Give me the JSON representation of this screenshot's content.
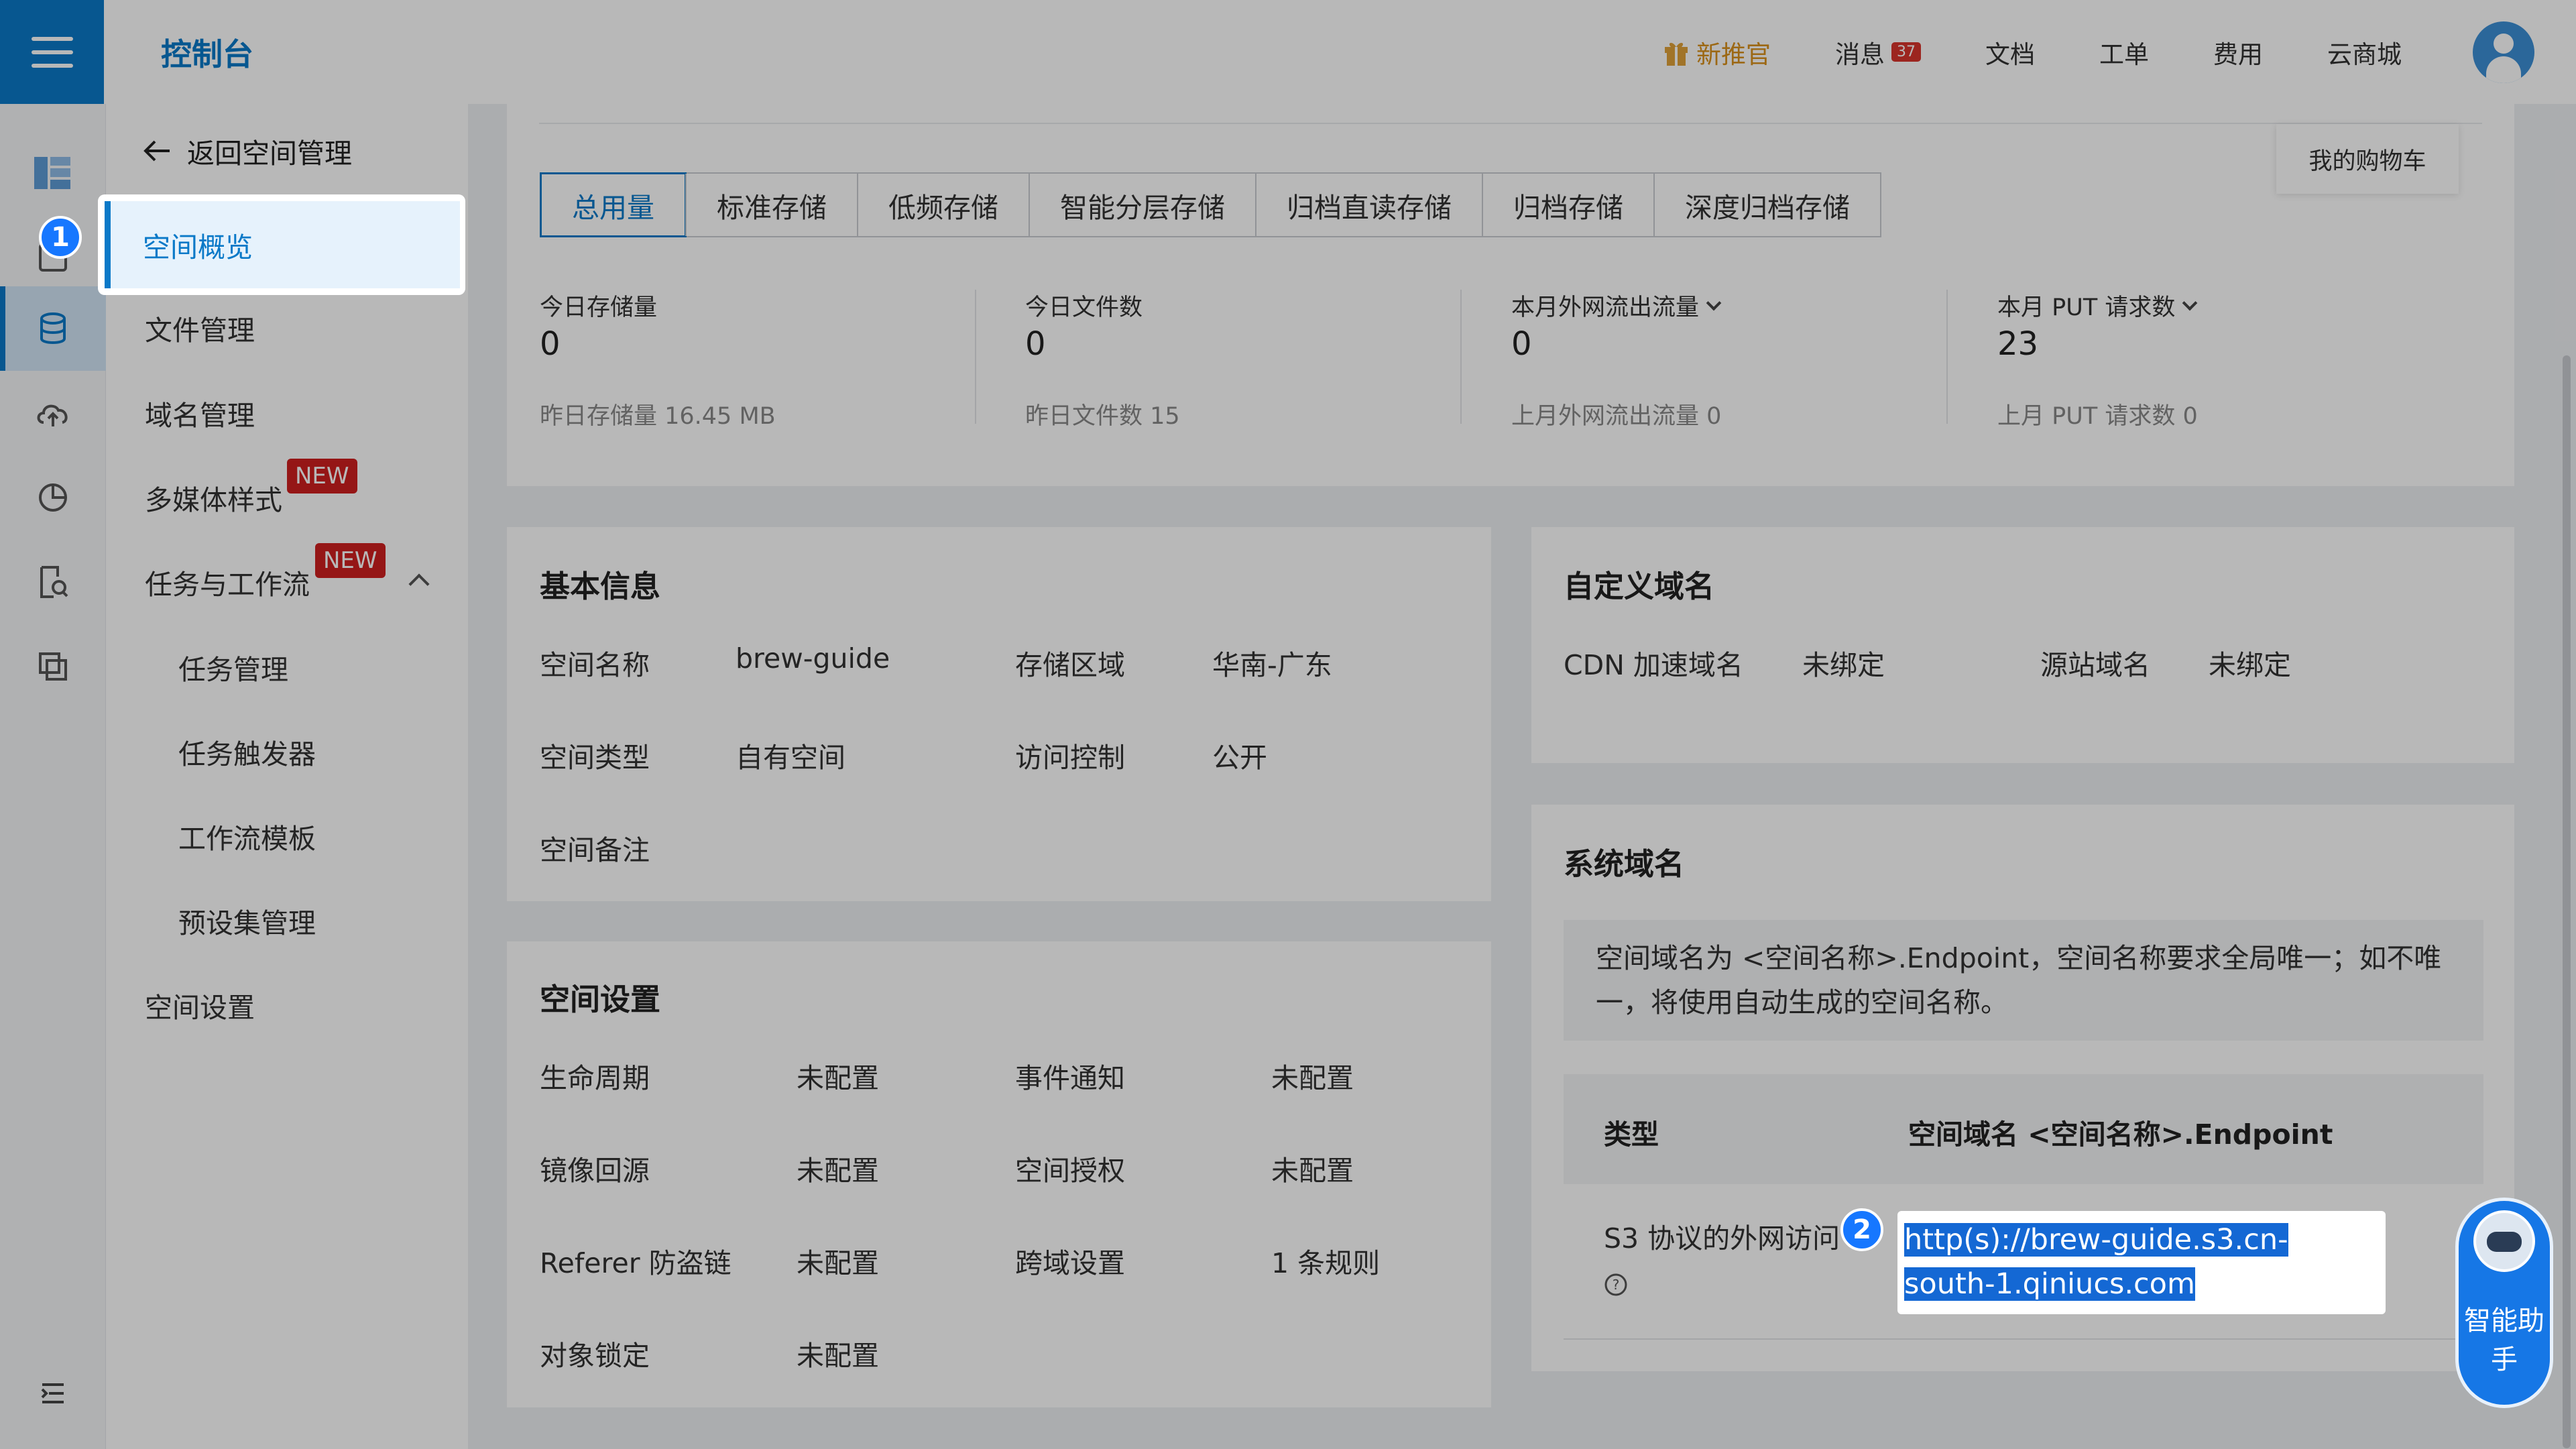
{
  "header": {
    "title": "控制台",
    "nav": {
      "promo": "新推官",
      "messages": "消息",
      "messages_count": "37",
      "docs": "文档",
      "tickets": "工单",
      "billing": "费用",
      "mall": "云商城"
    }
  },
  "rail": {
    "icons": [
      "dashboard-icon",
      "overview-icon",
      "database-icon",
      "cloud-upload-icon",
      "pie-chart-icon",
      "file-search-icon",
      "copy-icon",
      "collapse-menu-icon"
    ]
  },
  "sidebar": {
    "back": "返回空间管理",
    "items": [
      {
        "label": "空间概览"
      },
      {
        "label": "文件管理"
      },
      {
        "label": "域名管理"
      },
      {
        "label": "多媒体样式",
        "tag": "NEW"
      },
      {
        "label": "任务与工作流",
        "tag": "NEW"
      },
      {
        "label": "任务管理"
      },
      {
        "label": "任务触发器"
      },
      {
        "label": "工作流模板"
      },
      {
        "label": "预设集管理"
      },
      {
        "label": "空间设置"
      }
    ]
  },
  "cart": "我的购物车",
  "storage_tabs": [
    "总用量",
    "标准存储",
    "低频存储",
    "智能分层存储",
    "归档直读存储",
    "归档存储",
    "深度归档存储"
  ],
  "stats": [
    {
      "label": "今日存储量",
      "value": "0",
      "sub": "昨日存储量 16.45 MB"
    },
    {
      "label": "今日文件数",
      "value": "0",
      "sub": "昨日文件数 15"
    },
    {
      "label": "本月外网流出流量",
      "value": "0",
      "sub": "上月外网流出流量 0"
    },
    {
      "label": "本月 PUT 请求数",
      "value": "23",
      "sub": "上月 PUT 请求数 0"
    }
  ],
  "basic_info": {
    "title": "基本信息",
    "name_label": "空间名称",
    "name": "brew-guide",
    "region_label": "存储区域",
    "region": "华南-广东",
    "type_label": "空间类型",
    "type": "自有空间",
    "access_label": "访问控制",
    "access": "公开",
    "remark_label": "空间备注"
  },
  "space_settings": {
    "title": "空间设置",
    "lifecycle_label": "生命周期",
    "lifecycle": "未配置",
    "event_label": "事件通知",
    "event": "未配置",
    "mirror_label": "镜像回源",
    "mirror": "未配置",
    "auth_label": "空间授权",
    "auth": "未配置",
    "referer_label": "Referer 防盗链",
    "referer": "未配置",
    "cors_label": "跨域设置",
    "cors": "1 条规则",
    "lock_label": "对象锁定",
    "lock": "未配置"
  },
  "custom_domain": {
    "title": "自定义域名",
    "cdn_label": "CDN 加速域名",
    "cdn": "未绑定",
    "origin_label": "源站域名",
    "origin": "未绑定"
  },
  "system_domain": {
    "title": "系统域名",
    "note": "空间域名为 <空间名称>.Endpoint，空间名称要求全局唯一；如不唯一，将使用自动生成的空间名称。",
    "col_type": "类型",
    "col_domain": "空间域名 <空间名称>.Endpoint",
    "row_type": "S3 协议的外网访问",
    "row_domain": "http(s)://brew-guide.s3.cn-south-1.qiniucs.com"
  },
  "steps": [
    "1",
    "2"
  ],
  "assistant": "智能助手"
}
